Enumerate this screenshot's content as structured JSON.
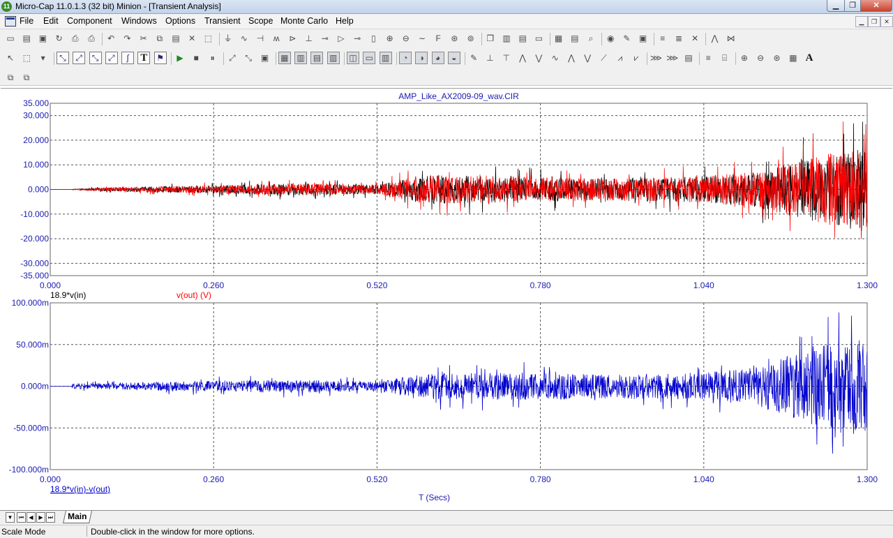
{
  "window": {
    "app_icon_glyph": "11",
    "title": "Micro-Cap 11.0.1.3 (32 bit) Minion - [Transient Analysis]",
    "min_icon": "minimize-icon",
    "max_icon": "maximize-icon",
    "close_icon": "close-icon"
  },
  "menubar": {
    "doc_icon": "document-icon",
    "items": [
      "File",
      "Edit",
      "Component",
      "Windows",
      "Options",
      "Transient",
      "Scope",
      "Monte Carlo",
      "Help"
    ]
  },
  "toolbar1": {
    "icons": [
      "new-file-icon",
      "open-file-icon",
      "save-icon",
      "revert-icon",
      "print-preview-icon",
      "print-icon",
      "undo-icon",
      "redo-icon",
      "cut-icon",
      "copy-icon",
      "paste-icon",
      "clear-icon",
      "select-all-icon",
      "ground-icon",
      "resistor-icon",
      "capacitor-icon",
      "inductor-icon",
      "diode-icon",
      "battery-icon",
      "npn-icon",
      "opamp-icon",
      "switch-icon",
      "crystal-icon",
      "source-icon",
      "pulse-source-icon",
      "sine-source-icon",
      "function-icon",
      "current-source-icon",
      "voltage-source-icon",
      "cascade-icon",
      "tile-vertical-icon",
      "tile-horizontal-icon",
      "window-icon",
      "calculator-icon",
      "component-list-icon",
      "find-icon",
      "globe-icon",
      "probe-icon",
      "pin-icon",
      "parts-icon",
      "netlist-icon",
      "tools-icon",
      "analysis-icon",
      "stepping-icon"
    ]
  },
  "toolbar2": {
    "icons": [
      "pointer-icon",
      "select-mode-icon",
      "dropdown-icon",
      "scale-mode-icon",
      "cursor-mode-icon",
      "zoom-mode-icon",
      "pan-mode-icon",
      "graph-icon",
      "text-icon",
      "properties-icon",
      "run-icon",
      "stop-icon",
      "pause-icon",
      "limits-icon",
      "step-icon",
      "data-points-icon",
      "tokens-icon",
      "grid-icon",
      "minor-grid-icon",
      "axis-icon",
      "horizontal-axis-icon",
      "vertical-axis-icon",
      "same-y-scale-icon",
      "zoom-in-icon",
      "zoom-out-icon",
      "zoom-fit-icon",
      "zoom-prev-icon",
      "annotate-icon",
      "peak-icon",
      "valley-icon",
      "high-icon",
      "low-icon",
      "inflection-icon",
      "global-high-icon",
      "global-low-icon",
      "slope-icon",
      "top-icon",
      "bottom-icon",
      "copy-plot-icon",
      "format-icon",
      "clipboard-icon",
      "align-icon",
      "scale-icon",
      "zoom-plus-icon",
      "zoom-minus-icon",
      "zoom-auto-icon",
      "layout-icon",
      "font-icon"
    ],
    "text_tool_label": "T",
    "font_tool_label": "A"
  },
  "toolbar3": {
    "icons": [
      "copy-window-icon",
      "duplicate-icon"
    ]
  },
  "plots": [
    {
      "title": "AMP_Like_AX2009-09_wav.CIR",
      "y_ticks": [
        "35.000",
        "30.000",
        "20.000",
        "10.000",
        "0.000",
        "-10.000",
        "-20.000",
        "-30.000",
        "-35.000"
      ],
      "x_ticks": [
        "0.000",
        "0.260",
        "0.520",
        "0.780",
        "1.040",
        "1.300"
      ],
      "legend": [
        {
          "text": "18.9*v(in)",
          "color": "#000000"
        },
        {
          "text": "v(out) (V)",
          "color": "#ff0000"
        }
      ]
    },
    {
      "title": "",
      "y_ticks": [
        "100.000m",
        "50.000m",
        "0.000m",
        "-50.000m",
        "-100.000m"
      ],
      "x_ticks": [
        "0.000",
        "0.260",
        "0.520",
        "0.780",
        "1.040",
        "1.300"
      ],
      "legend": [
        {
          "text": "18.9*v(in)-v(out)",
          "color": "#0000cc"
        }
      ],
      "xlabel": "T (Secs)"
    }
  ],
  "chart_data": [
    {
      "type": "line",
      "title": "AMP_Like_AX2009-09_wav.CIR",
      "xlabel": "",
      "ylabel": "",
      "xlim": [
        0,
        1.3
      ],
      "ylim": [
        -35,
        35
      ],
      "x_ticks": [
        0,
        0.26,
        0.52,
        0.78,
        1.04,
        1.3
      ],
      "y_ticks": [
        35,
        30,
        20,
        10,
        0,
        -10,
        -20,
        -30,
        -35
      ],
      "grid": true,
      "legend_placement": "bottom-left",
      "series": [
        {
          "name": "18.9*v(in)",
          "color": "#000000",
          "envelope": {
            "x": [
              0,
              0.04,
              0.1,
              0.26,
              0.4,
              0.52,
              0.6,
              0.78,
              0.9,
              1.04,
              1.12,
              1.2,
              1.25,
              1.3
            ],
            "amplitude": [
              0,
              0.3,
              1.5,
              3,
              4.5,
              3.5,
              11,
              9,
              8,
              10,
              13,
              22,
              28,
              31
            ]
          }
        },
        {
          "name": "v(out) (V)",
          "color": "#ff0000",
          "envelope": {
            "x": [
              0,
              0.04,
              0.1,
              0.26,
              0.4,
              0.52,
              0.6,
              0.78,
              0.9,
              1.04,
              1.12,
              1.2,
              1.25,
              1.3
            ],
            "amplitude": [
              0,
              0.3,
              1.5,
              3,
              4.5,
              3.5,
              11,
              9,
              8,
              10,
              13,
              22,
              28,
              31
            ]
          }
        }
      ]
    },
    {
      "type": "line",
      "title": "",
      "xlabel": "T (Secs)",
      "ylabel": "",
      "xlim": [
        0,
        1.3
      ],
      "ylim": [
        -0.1,
        0.1
      ],
      "x_ticks": [
        0,
        0.26,
        0.52,
        0.78,
        1.04,
        1.3
      ],
      "y_ticks": [
        0.1,
        0.05,
        0,
        -0.05,
        -0.1
      ],
      "grid": true,
      "legend_placement": "bottom-left",
      "series": [
        {
          "name": "18.9*v(in)-v(out)",
          "color": "#0000cc",
          "envelope": {
            "x": [
              0,
              0.04,
              0.1,
              0.26,
              0.4,
              0.52,
              0.6,
              0.78,
              0.9,
              1.04,
              1.12,
              1.2,
              1.25,
              1.3
            ],
            "amplitude": [
              0,
              0.006,
              0.007,
              0.012,
              0.014,
              0.01,
              0.028,
              0.03,
              0.027,
              0.03,
              0.04,
              0.08,
              0.095,
              0.1
            ]
          }
        }
      ]
    }
  ],
  "tabs": {
    "nav_icons": [
      "dropdown-icon",
      "first-page-icon",
      "prev-page-icon",
      "next-page-icon",
      "last-page-icon"
    ],
    "items": [
      "Main"
    ]
  },
  "status": {
    "mode": "Scale Mode",
    "message": "Double-click in the window for more options."
  }
}
